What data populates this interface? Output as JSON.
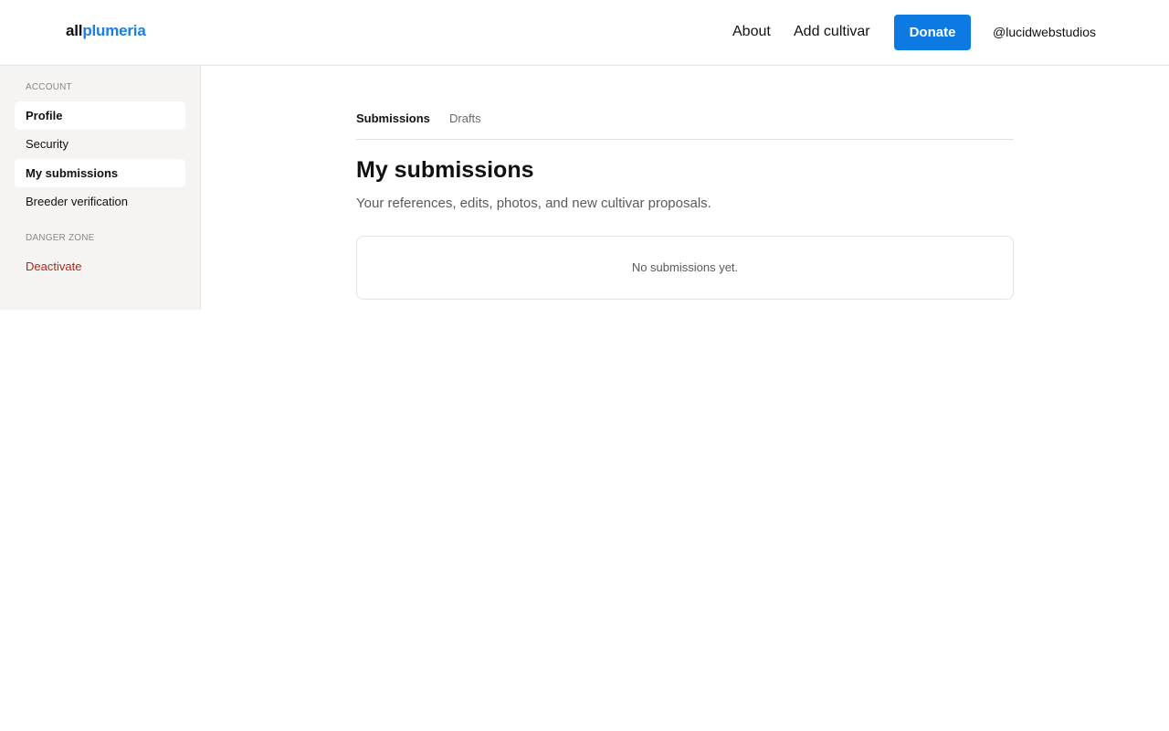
{
  "header": {
    "logo_part1": "all",
    "logo_part2": "plumeria",
    "nav": {
      "about": "About",
      "add_cultivar": "Add cultivar",
      "donate": "Donate"
    },
    "username": "@lucidwebstudios"
  },
  "sidebar": {
    "account_label": "ACCOUNT",
    "items": [
      {
        "label": "Profile"
      },
      {
        "label": "Security"
      },
      {
        "label": "My submissions"
      },
      {
        "label": "Breeder verification"
      }
    ],
    "danger_label": "DANGER ZONE",
    "danger_items": [
      {
        "label": "Deactivate"
      }
    ]
  },
  "main": {
    "tabs": [
      {
        "label": "Submissions"
      },
      {
        "label": "Drafts"
      }
    ],
    "title": "My submissions",
    "subtitle": "Your references, edits, photos, and new cultivar proposals.",
    "empty_message": "No submissions yet."
  },
  "colors": {
    "brand_blue": "#1a7fe0",
    "button_blue": "#0d79e3",
    "danger_red": "#b3261e",
    "sidebar_bg": "#f5f4f2"
  }
}
